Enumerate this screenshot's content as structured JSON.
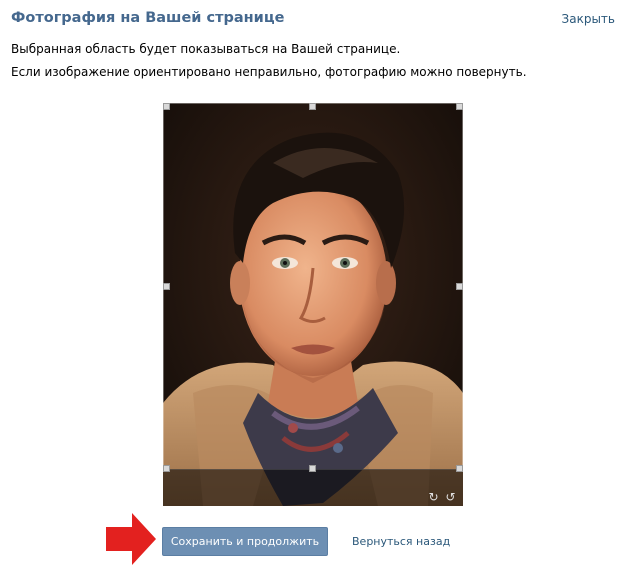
{
  "header": {
    "title": "Фотография на Вашей странице",
    "close_label": "Закрыть"
  },
  "description": {
    "line1": "Выбранная область будет показываться на Вашей странице.",
    "line2": "Если изображение ориентировано неправильно, фотографию можно повернуть."
  },
  "photo": {
    "rotate_left_icon": "rotate-left-icon",
    "rotate_right_icon": "rotate-right-icon"
  },
  "actions": {
    "save_label": "Сохранить и продолжить",
    "back_label": "Вернуться назад"
  },
  "colors": {
    "title": "#45688e",
    "link": "#2b587a",
    "button": "#6d8fb3",
    "arrow": "#e3211f"
  }
}
